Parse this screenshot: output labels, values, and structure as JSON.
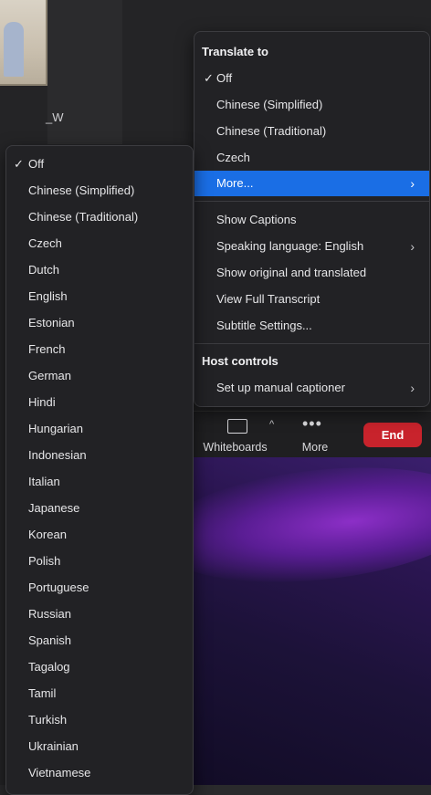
{
  "thumbnail": {
    "participant_name": "_W"
  },
  "translate_menu": {
    "header": "Translate to",
    "items": [
      {
        "label": "Off",
        "checked": true
      },
      {
        "label": "Chinese (Simplified)"
      },
      {
        "label": "Chinese (Traditional)"
      },
      {
        "label": "Czech"
      },
      {
        "label": "More...",
        "selected": true,
        "submenu": true
      }
    ],
    "caption_items": [
      {
        "label": "Show Captions"
      },
      {
        "label": "Speaking language: English",
        "submenu": true
      },
      {
        "label": "Show original and translated"
      },
      {
        "label": "View Full Transcript"
      },
      {
        "label": "Subtitle Settings..."
      }
    ],
    "host_header": "Host controls",
    "host_items": [
      {
        "label": "Set up manual captioner",
        "submenu": true
      }
    ]
  },
  "language_menu": {
    "items": [
      "Off",
      "Chinese (Simplified)",
      "Chinese (Traditional)",
      "Czech",
      "Dutch",
      "English",
      "Estonian",
      "French",
      "German",
      "Hindi",
      "Hungarian",
      "Indonesian",
      "Italian",
      "Japanese",
      "Korean",
      "Polish",
      "Portuguese",
      "Russian",
      "Spanish",
      "Tagalog",
      "Tamil",
      "Turkish",
      "Ukrainian",
      "Vietnamese"
    ],
    "checked_index": 0
  },
  "toolbar": {
    "whiteboards_label": "Whiteboards",
    "more_label": "More",
    "end_label": "End"
  },
  "icons": {
    "check": "check-icon",
    "chevron": "chevron-right-icon",
    "whiteboard": "whiteboard-icon",
    "more": "more-dots-icon",
    "caret_up": "caret-up-icon"
  },
  "colors": {
    "selected_bg": "#1a6ee5",
    "end_button": "#c8232c",
    "menu_bg": "#222225"
  }
}
